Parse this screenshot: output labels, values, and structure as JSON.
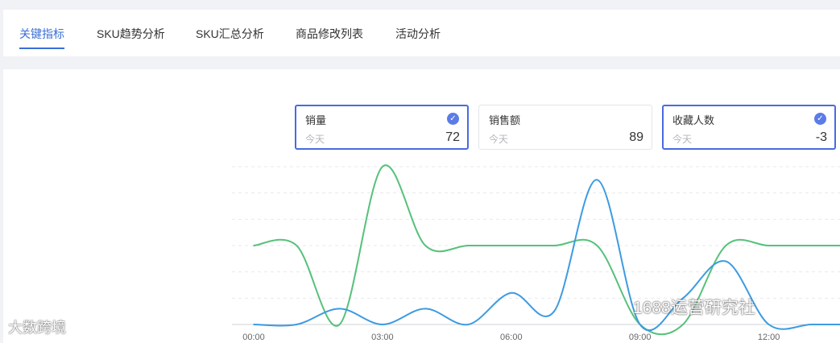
{
  "tabs": [
    {
      "label": "关键指标",
      "active": true
    },
    {
      "label": "SKU趋势分析",
      "active": false
    },
    {
      "label": "SKU汇总分析",
      "active": false
    },
    {
      "label": "商品修改列表",
      "active": false
    },
    {
      "label": "活动分析",
      "active": false
    }
  ],
  "metric_cards": [
    {
      "title": "销量",
      "sub": "今天",
      "value": "72",
      "selected": true
    },
    {
      "title": "销售额",
      "sub": "今天",
      "value": "89",
      "selected": false
    },
    {
      "title": "收藏人数",
      "sub": "今天",
      "value": "-3",
      "selected": true
    }
  ],
  "colors": {
    "accent": "#3a6fd8",
    "series_green": "#56c17a",
    "series_blue": "#3d9be0"
  },
  "chart_data": {
    "type": "line",
    "x_ticks": [
      "00:00",
      "03:00",
      "06:00",
      "09:00",
      "12:00"
    ],
    "x_hours": [
      0,
      1,
      2,
      3,
      4,
      5,
      6,
      7,
      8,
      9,
      10,
      11,
      12,
      13,
      14
    ],
    "grid": true,
    "ylim": [
      0,
      6
    ],
    "series": [
      {
        "color": "#56c17a",
        "values": [
          3,
          3,
          0,
          6,
          3,
          3,
          3,
          3,
          3,
          0,
          0,
          3,
          3,
          3,
          3
        ]
      },
      {
        "color": "#3d9be0",
        "values": [
          0,
          0,
          0.6,
          0,
          0.6,
          0,
          1.2,
          0.5,
          5.5,
          0,
          1,
          2.4,
          0,
          0,
          0
        ]
      }
    ]
  },
  "watermarks": {
    "left": "大数跨境",
    "right": "1688运营研究社"
  }
}
